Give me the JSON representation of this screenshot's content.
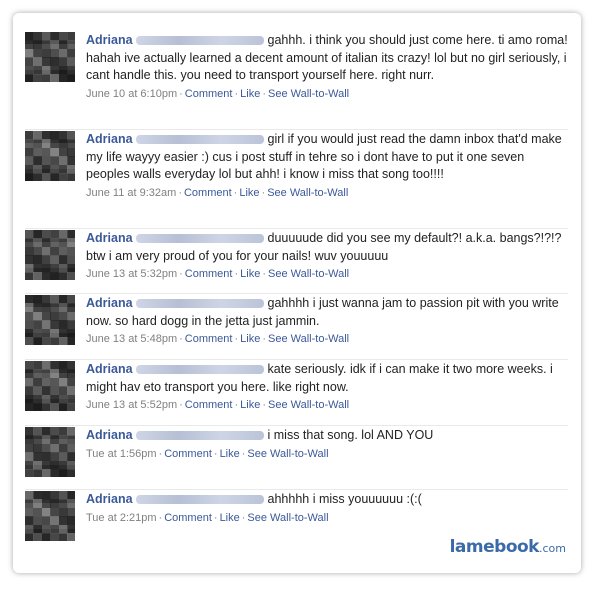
{
  "posts": [
    {
      "name": "Adriana",
      "message": "gahhh. i think you should just come here. ti amo roma! hahah ive actually learned a decent amount of italian its crazy! lol but no girl seriously, i cant handle this. you need to transport yourself here. right nurr.",
      "time": "June 10 at 6:10pm",
      "comment": "Comment",
      "like": "Like",
      "wall": "See Wall-to-Wall"
    },
    {
      "name": "Adriana",
      "message": "girl if you would just read the damn inbox that'd make my life wayyy easier :) cus i post stuff in tehre so i dont have to put it one seven peoples walls everyday lol but ahh! i know i miss that song too!!!!",
      "time": "June 11 at 9:32am",
      "comment": "Comment",
      "like": "Like",
      "wall": "See Wall-to-Wall"
    },
    {
      "name": "Adriana",
      "message": "duuuuude did you see my default?! a.k.a. bangs?!?!? btw i am very proud of you for your nails! wuv youuuuu",
      "time": "June 13 at 5:32pm",
      "comment": "Comment",
      "like": "Like",
      "wall": "See Wall-to-Wall"
    },
    {
      "name": "Adriana",
      "message": "gahhhh i just wanna jam to passion pit with you write now. so hard dogg in the jetta just jammin.",
      "time": "June 13 at 5:48pm",
      "comment": "Comment",
      "like": "Like",
      "wall": "See Wall-to-Wall"
    },
    {
      "name": "Adriana",
      "message": "kate seriously. idk if i can make it two more weeks. i might hav eto transport you here. like right now.",
      "time": "June 13 at 5:52pm",
      "comment": "Comment",
      "like": "Like",
      "wall": "See Wall-to-Wall"
    },
    {
      "name": "Adriana",
      "message": "i miss that song. lol AND YOU",
      "time": "Tue at 1:56pm",
      "comment": "Comment",
      "like": "Like",
      "wall": "See Wall-to-Wall"
    },
    {
      "name": "Adriana",
      "message": "ahhhhh i miss youuuuuu :(:(",
      "time": "Tue at 2:21pm",
      "comment": "Comment",
      "like": "Like",
      "wall": "See Wall-to-Wall"
    }
  ],
  "separator": "·",
  "brand": {
    "name": "lamebook",
    "tld": ".com"
  },
  "colors": {
    "link": "#3b5998",
    "text": "#222222",
    "meta": "#808080",
    "brand": "#3b6aa8"
  }
}
